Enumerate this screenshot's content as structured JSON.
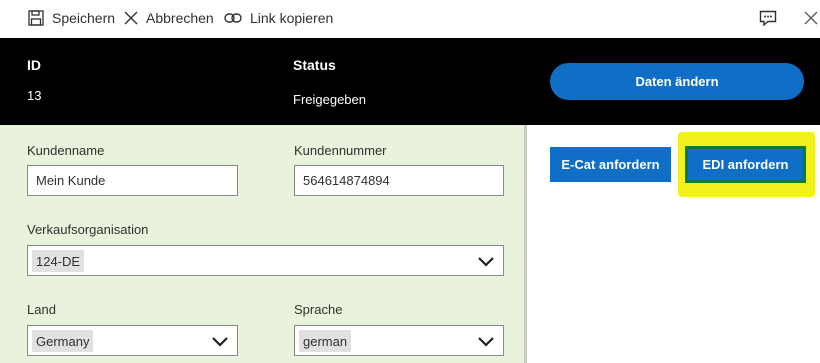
{
  "toolbar": {
    "save_label": "Speichern",
    "cancel_label": "Abbrechen",
    "copy_link_label": "Link kopieren"
  },
  "header": {
    "id_label": "ID",
    "id_value": "13",
    "status_label": "Status",
    "status_value": "Freigegeben",
    "change_button": "Daten ändern"
  },
  "form": {
    "customer_name_label": "Kundenname",
    "customer_name_value": "Mein Kunde",
    "customer_number_label": "Kundennummer",
    "customer_number_value": "564614874894",
    "sales_org_label": "Verkaufsorganisation",
    "sales_org_value": "124-DE",
    "country_label": "Land",
    "country_value": "Germany",
    "language_label": "Sprache",
    "language_value": "german"
  },
  "actions": {
    "ecat_button": "E-Cat anfordern",
    "edi_button": "EDI anfordern"
  },
  "icons": {
    "save": "save-icon",
    "cancel": "cancel-icon",
    "copy_link": "link-icon",
    "feedback": "feedback-icon",
    "close": "close-icon",
    "dropdown": "chevron-down-icon"
  },
  "colors": {
    "header_background": "#000000",
    "primary_button": "#0f6fc6",
    "form_background": "#e8f2dc",
    "highlight": "#f3f11d",
    "highlight_border": "#0b7a3a"
  }
}
